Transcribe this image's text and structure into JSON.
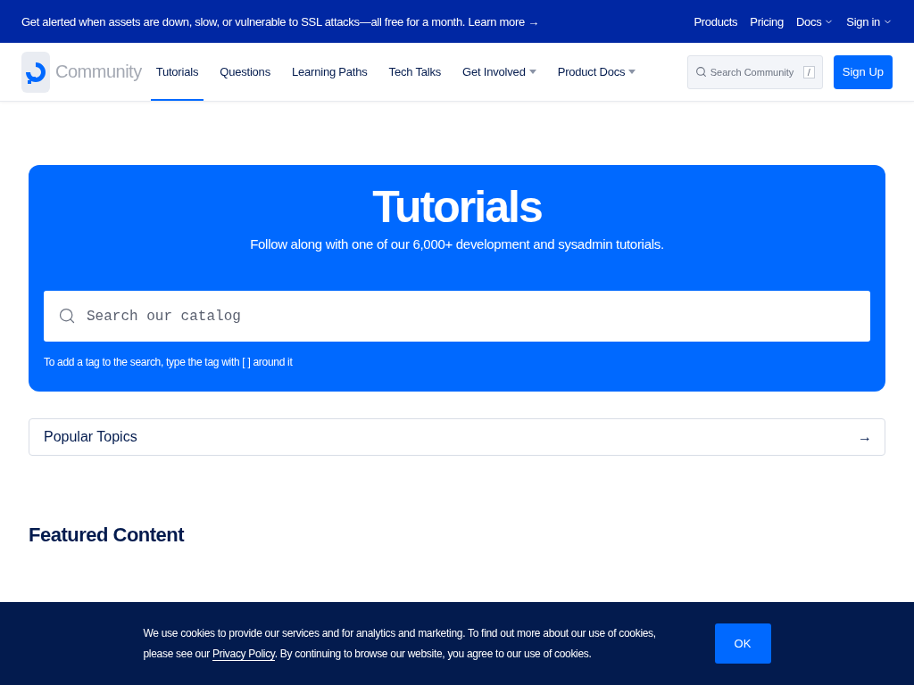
{
  "announcement": {
    "text": "Get alerted when assets are down, slow, or vulnerable to SSL attacks—all free for a month. Learn more",
    "arrow": "→"
  },
  "top_links": [
    {
      "label": "Products",
      "dropdown": false
    },
    {
      "label": "Pricing",
      "dropdown": false
    },
    {
      "label": "Docs",
      "dropdown": true
    },
    {
      "label": "Sign in",
      "dropdown": true
    }
  ],
  "brand": "Community",
  "nav": [
    {
      "label": "Tutorials",
      "selected": true,
      "dropdown": false
    },
    {
      "label": "Questions",
      "selected": false,
      "dropdown": false
    },
    {
      "label": "Learning Paths",
      "selected": false,
      "dropdown": false
    },
    {
      "label": "Tech Talks",
      "selected": false,
      "dropdown": false
    },
    {
      "label": "Get Involved",
      "selected": false,
      "dropdown": true
    },
    {
      "label": "Product Docs",
      "selected": false,
      "dropdown": true
    }
  ],
  "nav_search": {
    "placeholder": "Search Community",
    "shortcut": "/"
  },
  "signup": "Sign Up",
  "hero": {
    "title": "Tutorials",
    "subtitle": "Follow along with one of our 6,000+ development and sysadmin tutorials.",
    "search_placeholder": "Search our catalog",
    "hint": "To add a tag to the search, type the tag with [ ] around it"
  },
  "popular_topics": {
    "label": "Popular Topics",
    "arrow": "→"
  },
  "featured_heading": "Featured Content",
  "cookie": {
    "before": "We use cookies to provide our services and for analytics and marketing. To find out more about our use of cookies, please see our",
    "link": "Privacy Policy",
    "after": ". By continuing to browse our website, you agree to our use of cookies.",
    "button": "OK"
  }
}
